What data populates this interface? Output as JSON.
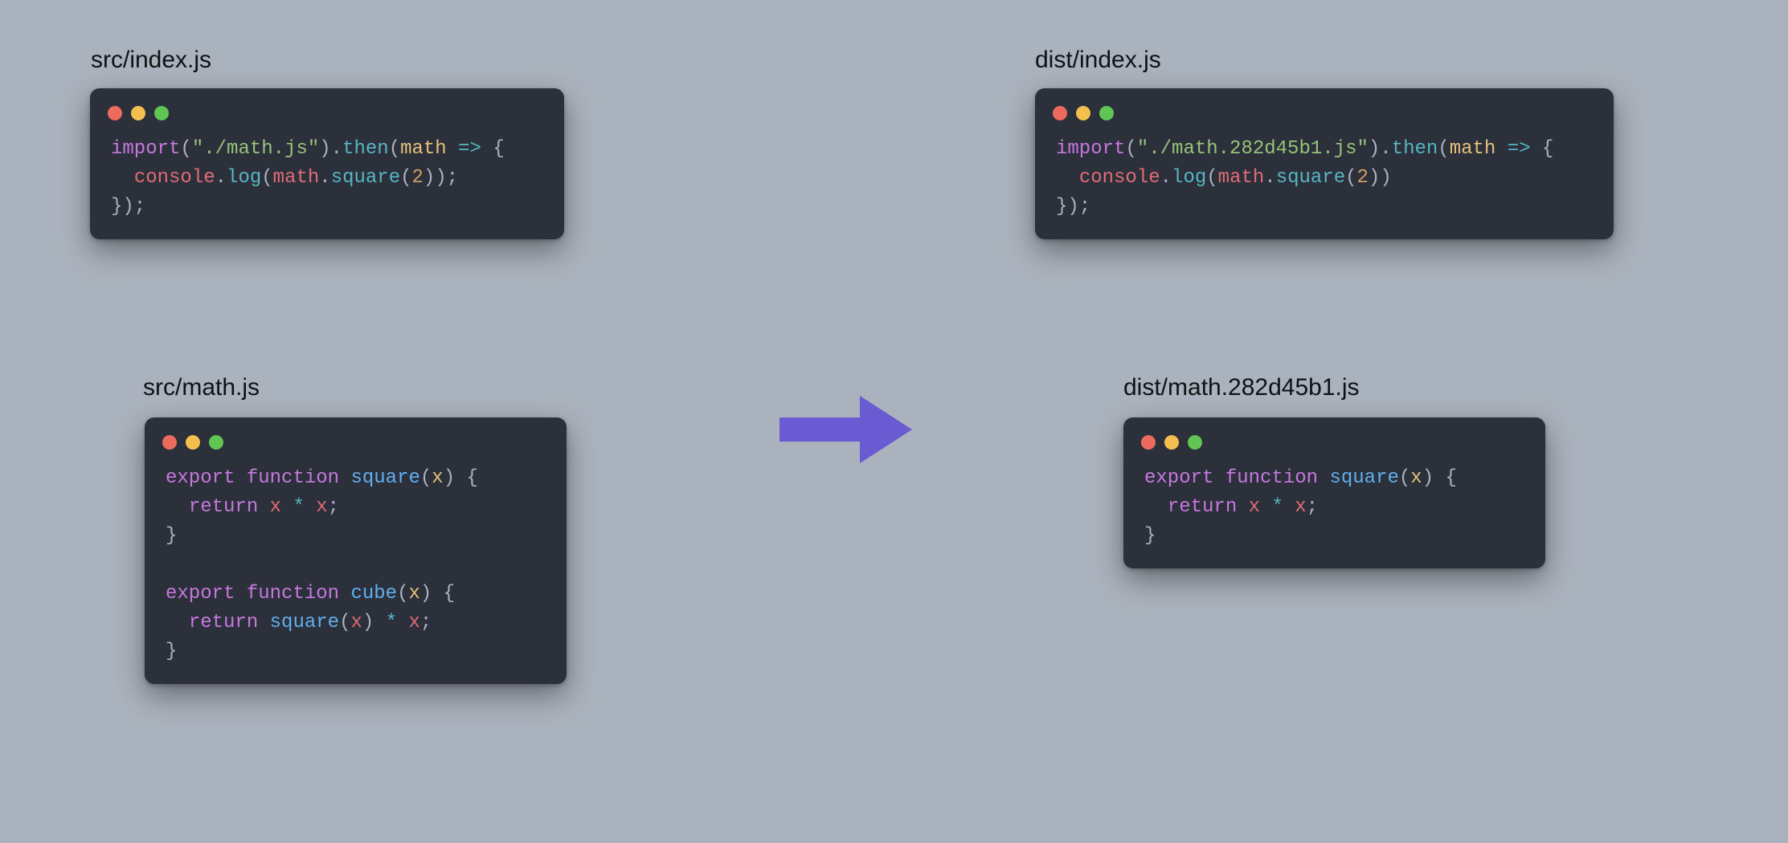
{
  "colors": {
    "background": "#aab2bd",
    "window_bg": "#2b303b",
    "arrow": "#6b5bd2",
    "traffic_red": "#ed6a5e",
    "traffic_yellow": "#f5bf4f",
    "traffic_green": "#61c554",
    "syntax": {
      "keyword": "#c678dd",
      "string": "#98c379",
      "number": "#d19a66",
      "call": "#56b6c2",
      "function_name": "#61afef",
      "param": "#e5c07b",
      "ident": "#e06c75",
      "punct": "#abb2bf",
      "op": "#56b6c2"
    }
  },
  "labels": {
    "src_index": "src/index.js",
    "src_math": "src/math.js",
    "dist_index": "dist/index.js",
    "dist_math": "dist/math.282d45b1.js"
  },
  "code": {
    "src_index": [
      [
        {
          "t": "key",
          "v": "import"
        },
        {
          "t": "punct",
          "v": "("
        },
        {
          "t": "str",
          "v": "\"./math.js\""
        },
        {
          "t": "punct",
          "v": ")."
        },
        {
          "t": "call",
          "v": "then"
        },
        {
          "t": "punct",
          "v": "("
        },
        {
          "t": "param",
          "v": "math"
        },
        {
          "t": "punct",
          "v": " "
        },
        {
          "t": "op",
          "v": "=>"
        },
        {
          "t": "punct",
          "v": " {"
        }
      ],
      [
        {
          "t": "punct",
          "v": "  "
        },
        {
          "t": "ident",
          "v": "console"
        },
        {
          "t": "punct",
          "v": "."
        },
        {
          "t": "call",
          "v": "log"
        },
        {
          "t": "punct",
          "v": "("
        },
        {
          "t": "ident",
          "v": "math"
        },
        {
          "t": "punct",
          "v": "."
        },
        {
          "t": "call",
          "v": "square"
        },
        {
          "t": "punct",
          "v": "("
        },
        {
          "t": "num",
          "v": "2"
        },
        {
          "t": "punct",
          "v": "));"
        }
      ],
      [
        {
          "t": "punct",
          "v": "});"
        }
      ]
    ],
    "src_math": [
      [
        {
          "t": "key",
          "v": "export"
        },
        {
          "t": "punct",
          "v": " "
        },
        {
          "t": "key",
          "v": "function"
        },
        {
          "t": "punct",
          "v": " "
        },
        {
          "t": "fn",
          "v": "square"
        },
        {
          "t": "punct",
          "v": "("
        },
        {
          "t": "param",
          "v": "x"
        },
        {
          "t": "punct",
          "v": ") {"
        }
      ],
      [
        {
          "t": "punct",
          "v": "  "
        },
        {
          "t": "key",
          "v": "return"
        },
        {
          "t": "punct",
          "v": " "
        },
        {
          "t": "ident",
          "v": "x"
        },
        {
          "t": "punct",
          "v": " "
        },
        {
          "t": "op",
          "v": "*"
        },
        {
          "t": "punct",
          "v": " "
        },
        {
          "t": "ident",
          "v": "x"
        },
        {
          "t": "punct",
          "v": ";"
        }
      ],
      [
        {
          "t": "punct",
          "v": "}"
        }
      ],
      [
        {
          "t": "punct",
          "v": ""
        }
      ],
      [
        {
          "t": "key",
          "v": "export"
        },
        {
          "t": "punct",
          "v": " "
        },
        {
          "t": "key",
          "v": "function"
        },
        {
          "t": "punct",
          "v": " "
        },
        {
          "t": "fn",
          "v": "cube"
        },
        {
          "t": "punct",
          "v": "("
        },
        {
          "t": "param",
          "v": "x"
        },
        {
          "t": "punct",
          "v": ") {"
        }
      ],
      [
        {
          "t": "punct",
          "v": "  "
        },
        {
          "t": "key",
          "v": "return"
        },
        {
          "t": "punct",
          "v": " "
        },
        {
          "t": "fn",
          "v": "square"
        },
        {
          "t": "punct",
          "v": "("
        },
        {
          "t": "ident",
          "v": "x"
        },
        {
          "t": "punct",
          "v": ") "
        },
        {
          "t": "op",
          "v": "*"
        },
        {
          "t": "punct",
          "v": " "
        },
        {
          "t": "ident",
          "v": "x"
        },
        {
          "t": "punct",
          "v": ";"
        }
      ],
      [
        {
          "t": "punct",
          "v": "}"
        }
      ]
    ],
    "dist_index": [
      [
        {
          "t": "key",
          "v": "import"
        },
        {
          "t": "punct",
          "v": "("
        },
        {
          "t": "str",
          "v": "\"./math.282d45b1.js\""
        },
        {
          "t": "punct",
          "v": ")."
        },
        {
          "t": "call",
          "v": "then"
        },
        {
          "t": "punct",
          "v": "("
        },
        {
          "t": "param",
          "v": "math"
        },
        {
          "t": "punct",
          "v": " "
        },
        {
          "t": "op",
          "v": "=>"
        },
        {
          "t": "punct",
          "v": " {"
        }
      ],
      [
        {
          "t": "punct",
          "v": "  "
        },
        {
          "t": "ident",
          "v": "console"
        },
        {
          "t": "punct",
          "v": "."
        },
        {
          "t": "call",
          "v": "log"
        },
        {
          "t": "punct",
          "v": "("
        },
        {
          "t": "ident",
          "v": "math"
        },
        {
          "t": "punct",
          "v": "."
        },
        {
          "t": "call",
          "v": "square"
        },
        {
          "t": "punct",
          "v": "("
        },
        {
          "t": "num",
          "v": "2"
        },
        {
          "t": "punct",
          "v": "))"
        }
      ],
      [
        {
          "t": "punct",
          "v": "});"
        }
      ]
    ],
    "dist_math": [
      [
        {
          "t": "key",
          "v": "export"
        },
        {
          "t": "punct",
          "v": " "
        },
        {
          "t": "key",
          "v": "function"
        },
        {
          "t": "punct",
          "v": " "
        },
        {
          "t": "fn",
          "v": "square"
        },
        {
          "t": "punct",
          "v": "("
        },
        {
          "t": "param",
          "v": "x"
        },
        {
          "t": "punct",
          "v": ") {"
        }
      ],
      [
        {
          "t": "punct",
          "v": "  "
        },
        {
          "t": "key",
          "v": "return"
        },
        {
          "t": "punct",
          "v": " "
        },
        {
          "t": "ident",
          "v": "x"
        },
        {
          "t": "punct",
          "v": " "
        },
        {
          "t": "op",
          "v": "*"
        },
        {
          "t": "punct",
          "v": " "
        },
        {
          "t": "ident",
          "v": "x"
        },
        {
          "t": "punct",
          "v": ";"
        }
      ],
      [
        {
          "t": "punct",
          "v": "}"
        }
      ]
    ]
  }
}
